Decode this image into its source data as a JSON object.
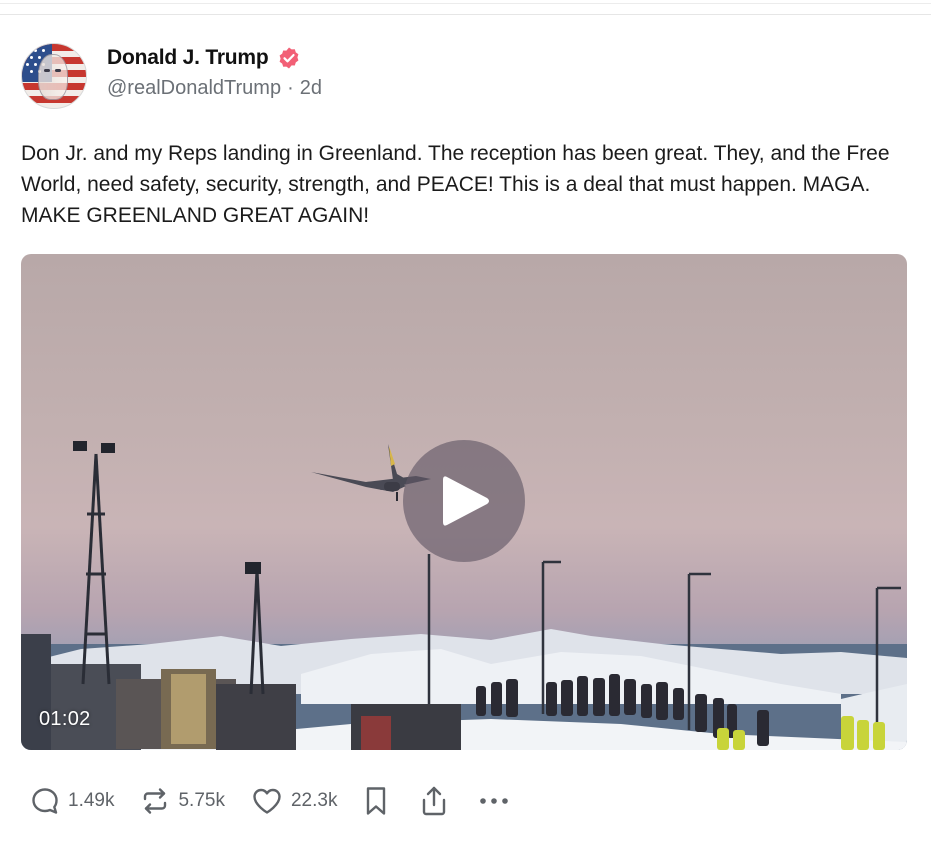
{
  "author": {
    "display_name": "Donald J. Trump",
    "handle": "@realDonaldTrump",
    "separator": "·",
    "age": "2d",
    "verified_color": "#f26076"
  },
  "post": {
    "text": "Don Jr. and my Reps landing in Greenland. The reception has been great. They, and the Free World, need safety, security, strength, and PEACE! This is a deal that must happen. MAGA. MAKE GREENLAND GREAT AGAIN!"
  },
  "video": {
    "duration": "01:02",
    "play_icon": "play-icon"
  },
  "actions": {
    "replies": {
      "icon": "reply-icon",
      "count": "1.49k"
    },
    "reposts": {
      "icon": "repost-icon",
      "count": "5.75k"
    },
    "likes": {
      "icon": "heart-icon",
      "count": "22.3k"
    },
    "bookmark": {
      "icon": "bookmark-icon"
    },
    "share": {
      "icon": "share-icon"
    },
    "more": {
      "icon": "more-icon"
    }
  },
  "colors": {
    "text": "#1b1b1b",
    "muted": "#6b7076",
    "icon": "#5f6368"
  }
}
